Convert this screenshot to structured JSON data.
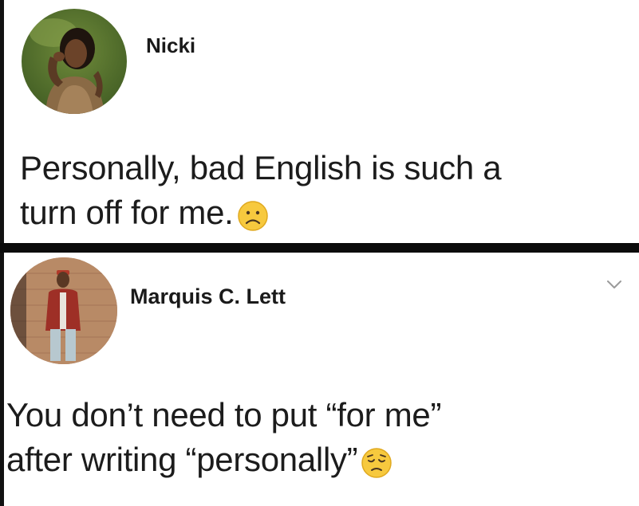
{
  "posts": [
    {
      "author": "Nicki",
      "lines": [
        "Personally, bad English is such a",
        "turn off for me."
      ],
      "emoji": "frowning-face-icon"
    },
    {
      "author": "Marquis C. Lett",
      "lines": [
        "You don’t need to put “for me”",
        "after writing “personally”"
      ],
      "emoji": "pensive-face-icon"
    }
  ],
  "colors": {
    "text": "#1c1c1c",
    "divider": "#0b0b0b",
    "emoji_yellow": "#f7c93e",
    "chevron": "#9a9a9a"
  }
}
